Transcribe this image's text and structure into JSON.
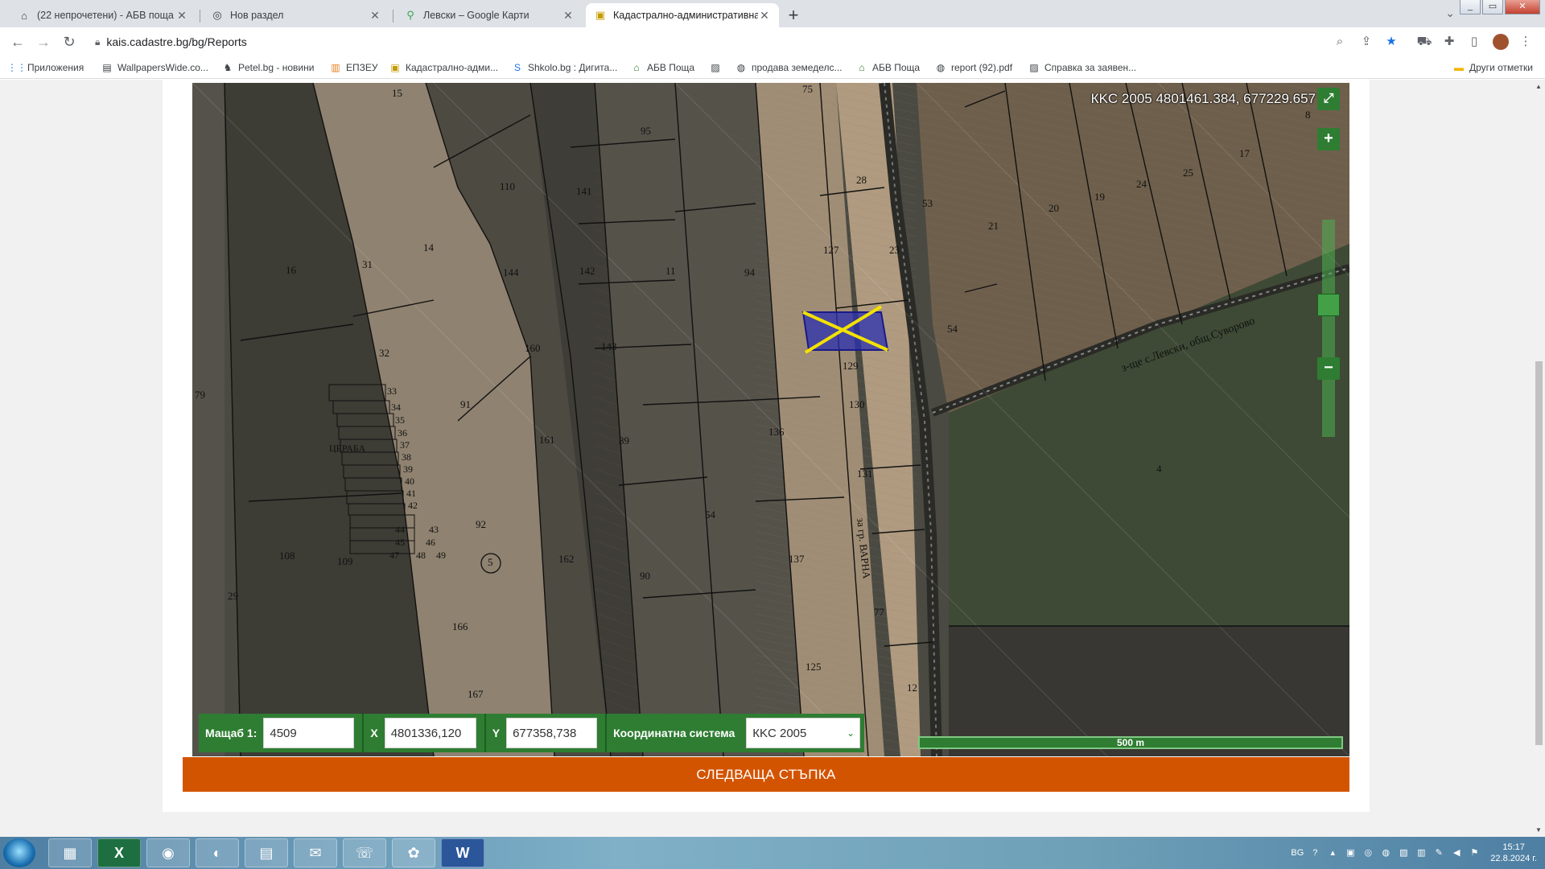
{
  "browser": {
    "tabs": [
      {
        "title": "(22 непрочетени) - АБВ поща",
        "icon": "home-icon",
        "active": false
      },
      {
        "title": "Нов раздел",
        "icon": "chrome-icon",
        "active": false
      },
      {
        "title": "Левски – Google Карти",
        "icon": "map-pin-icon",
        "active": false
      },
      {
        "title": "Кадастрално-административна",
        "icon": "cadastre-icon",
        "active": true
      }
    ],
    "url": "kais.cadastre.bg/bg/Reports",
    "bookmarks": [
      {
        "label": "Приложения",
        "icon": "apps-grid-icon"
      },
      {
        "label": "WallpapersWide.co...",
        "icon": "wallpaper-icon"
      },
      {
        "label": "Petel.bg - новини",
        "icon": "rooster-icon"
      },
      {
        "label": "ЕПЗЕУ",
        "icon": "building-icon"
      },
      {
        "label": "Кадастрално-адми...",
        "icon": "cadastre-icon"
      },
      {
        "label": "Shkolo.bg : Дигита...",
        "icon": "shkolo-icon"
      },
      {
        "label": "АБВ Поща",
        "icon": "home-icon"
      },
      {
        "label": "",
        "icon": "broken-image-icon"
      },
      {
        "label": "продава земеделс...",
        "icon": "globe-icon"
      },
      {
        "label": "АБВ Поща",
        "icon": "home-icon"
      },
      {
        "label": "report (92).pdf",
        "icon": "globe-icon"
      },
      {
        "label": "Справка за заявен...",
        "icon": "broken-image-icon"
      }
    ],
    "other_bookmarks": "Други отметки"
  },
  "map": {
    "coord_readout": "КKC 2005 4801461.384, 677229.657",
    "parcels": [
      "15",
      "75",
      "95",
      "110",
      "141",
      "16",
      "14",
      "31",
      "144",
      "142",
      "11",
      "94",
      "127",
      "23",
      "53",
      "21",
      "20",
      "19",
      "24",
      "25",
      "17",
      "28",
      "8",
      "160",
      "143",
      "32",
      "129",
      "54",
      "33",
      "34",
      "35",
      "36",
      "37",
      "38",
      "39",
      "40",
      "41",
      "42",
      "43",
      "44",
      "45",
      "46",
      "47",
      "48",
      "49",
      "79",
      "91",
      "161",
      "89",
      "136",
      "130",
      "131",
      "4",
      "ЦЕРАБА",
      "108",
      "109",
      "92",
      "5",
      "162",
      "90",
      "54",
      "137",
      "29",
      "166",
      "77",
      "167",
      "125",
      "12"
    ],
    "road_labels": [
      "з-ще с.Левски, общ.Суворово",
      "за гр. ВАРНА"
    ],
    "colors": {
      "selection_fill": "#2a2fb0",
      "selection_cross": "#f2e200",
      "accent_green": "#2e7d32",
      "next_step": "#d35400"
    }
  },
  "controls": {
    "scale_label": "Мащаб 1:",
    "scale_value": "4509",
    "x_label": "X",
    "x_value": "4801336,120",
    "y_label": "Y",
    "y_value": "677358,738",
    "crs_label": "Координатна система",
    "crs_value": "КKC 2005",
    "scalebar_label": "500 m",
    "next_step": "СЛЕДВАЩА СТЪПКА"
  },
  "taskbar": {
    "apps": [
      "task-manager-icon",
      "excel-icon",
      "chrome-icon",
      "firefox-icon",
      "explorer-icon",
      "outlook-icon",
      "viber-icon",
      "picasa-icon",
      "word-icon"
    ],
    "lang": "BG",
    "time": "15:17",
    "date": "22.8.2024 г."
  }
}
